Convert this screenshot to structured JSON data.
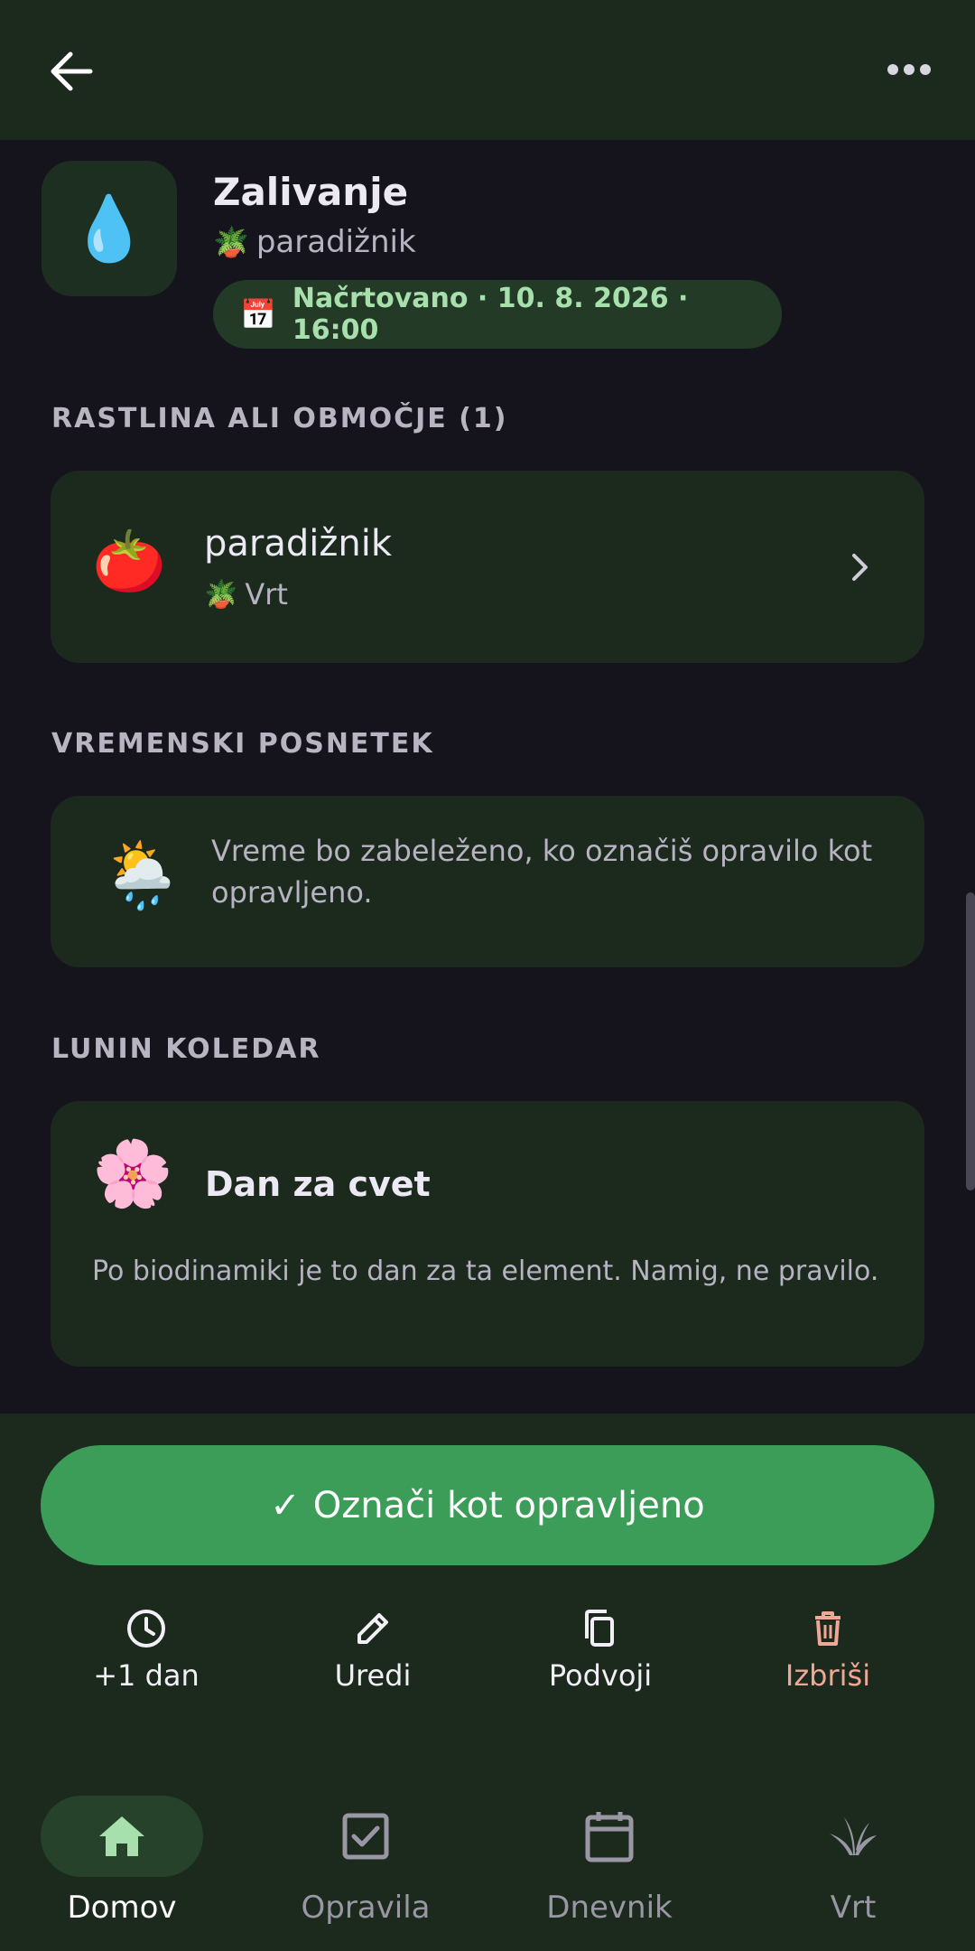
{
  "header": {
    "back_icon": "arrow-left-icon",
    "more_icon": "more-horizontal-icon"
  },
  "task": {
    "icon": "💧",
    "title": "Zalivanje",
    "plant_icon": "🪴",
    "plant_name": "paradižnik",
    "status_icon": "📅",
    "status_text": "Načrtovano · 10. 8. 2026 · 16:00"
  },
  "plants_section": {
    "label": "RASTLINA ALI OBMOČJE (1)",
    "item": {
      "icon": "🍅",
      "name": "paradižnik",
      "location_icon": "🪴",
      "location": "Vrt"
    }
  },
  "weather_section": {
    "label": "VREMENSKI POSNETEK",
    "icon": "🌦️",
    "text": "Vreme bo zabeleženo, ko označiš opravilo kot opravljeno."
  },
  "moon_section": {
    "label": "LUNIN KOLEDAR",
    "icon": "🌸",
    "title": "Dan za cvet",
    "text": "Po biodinamiki je to dan za ta element. Namig, ne pravilo."
  },
  "primary_action": {
    "check": "✓",
    "label": "Označi kot opravljeno"
  },
  "actions": [
    {
      "label": "+1 dan",
      "icon": "clock-icon"
    },
    {
      "label": "Uredi",
      "icon": "pencil-icon"
    },
    {
      "label": "Podvoji",
      "icon": "copy-icon"
    },
    {
      "label": "Izbriši",
      "icon": "trash-icon"
    }
  ],
  "nav": [
    {
      "label": "Domov",
      "icon": "home-icon",
      "active": true
    },
    {
      "label": "Opravila",
      "icon": "checkbox-icon",
      "active": false
    },
    {
      "label": "Dnevnik",
      "icon": "calendar-icon",
      "active": false
    },
    {
      "label": "Vrt",
      "icon": "plant-icon",
      "active": false
    }
  ],
  "colors": {
    "background": "#15141c",
    "surface": "#1c2a1e",
    "accent": "#3c9d59",
    "status_text": "#a8e0ad",
    "danger": "#f0a896"
  }
}
